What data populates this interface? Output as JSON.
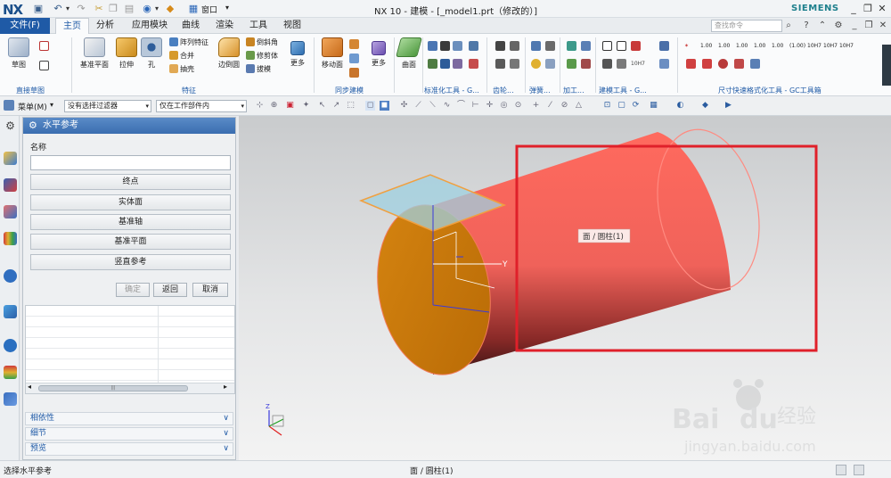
{
  "app": {
    "logo": "NX",
    "title": "NX 10 - 建模 - [_model1.prt（修改的）]",
    "brand": "SIEMENS",
    "window_menu": "窗口",
    "qa_arrow": "▾"
  },
  "window_controls": {
    "min": "_",
    "restore": "❐",
    "close": "✕"
  },
  "menu": {
    "tabs": [
      "文件(F)",
      "主页",
      "分析",
      "应用模块",
      "曲线",
      "渲染",
      "工具",
      "视图"
    ],
    "active_index": 1,
    "search_placeholder": "查找命令"
  },
  "ribbon": {
    "sketch": {
      "label": "草图",
      "group": "直接草图"
    },
    "feature": {
      "datum_plane": "基准平面",
      "extrude": "拉伸",
      "hole": "孔",
      "pattern_feature": "阵列特征",
      "unite": "合并",
      "shell": "抽壳",
      "edge_blend": "边倒圆",
      "chamfer": "倒斜角",
      "trim_body": "修剪体",
      "draft": "拔模",
      "more": "更多",
      "group": "特征"
    },
    "sync": {
      "move_face": "移动面",
      "more": "更多",
      "group": "同步建模"
    },
    "surface": {
      "label": "曲面"
    },
    "groups": [
      "标准化工具 - G...",
      "齿轮...",
      "弹簧...",
      "加工...",
      "建模工具 - G...",
      "尺寸快速格式化工具 - GC工具箱"
    ],
    "dim_tags": [
      "1.00",
      "1.00",
      "1.00",
      "1.00",
      "1.00",
      "(1.00)",
      "10H7",
      "10H7",
      "10H7"
    ]
  },
  "selection_bar": {
    "menu_label": "菜单(M)",
    "filter": "没有选择过滤器",
    "scope": "仅在工作部件内",
    "arrow": "▾"
  },
  "dialog": {
    "title": "水平参考",
    "name_label": "名称",
    "name_value": "",
    "options": [
      "终点",
      "实体面",
      "基准轴",
      "基准平面",
      "竖直参考"
    ],
    "ok": "确定",
    "back": "返回",
    "cancel": "取消",
    "sections": [
      "相依性",
      "细节",
      "预览"
    ],
    "chev": "∨",
    "scroll_left": "◂",
    "scroll_right": "▸",
    "scroll_grip": "|||"
  },
  "graphics": {
    "tooltip": "面 / 圆柱(1)",
    "axis_y": "Y",
    "axis_z": "Z",
    "watermark_brand": "Bai",
    "watermark_du": "du",
    "watermark_cn": "经验",
    "watermark_url": "jingyan.baidu.com"
  },
  "status": {
    "left": "选择水平参考",
    "center": "面 / 圆柱(1)"
  },
  "colors": {
    "accent": "#1f5aa6",
    "cylinder": "#f0645c",
    "endcap": "#cc7a08",
    "highlight_box": "#e0202a",
    "plane": "#9fd0e0"
  }
}
